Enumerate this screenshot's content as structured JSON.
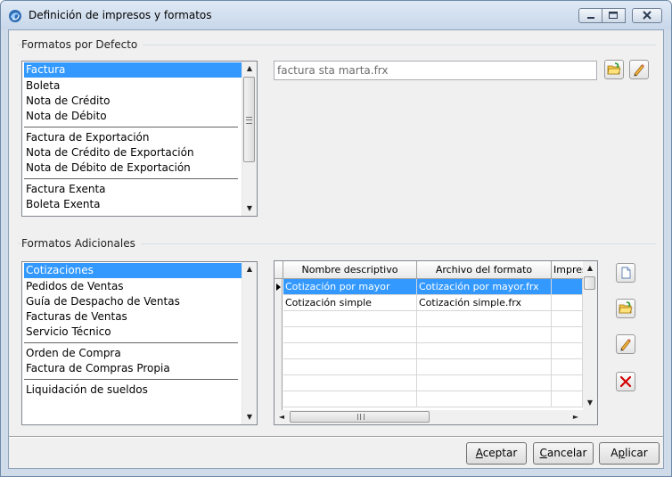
{
  "window": {
    "title": "Definición de impresos y formatos",
    "title_icon": "app-swirl-icon",
    "controls": [
      "minimize-icon",
      "maximize-icon",
      "close-icon"
    ]
  },
  "default_formats": {
    "group_title": "Formatos por Defecto",
    "items": [
      {
        "label": "Factura",
        "selected": true
      },
      {
        "label": "Boleta"
      },
      {
        "label": "Nota de Crédito"
      },
      {
        "label": "Nota de Débito",
        "separator_after": true
      },
      {
        "label": "Factura de Exportación"
      },
      {
        "label": "Nota de Crédito de Exportación"
      },
      {
        "label": "Nota de Débito de Exportación",
        "separator_after": true
      },
      {
        "label": "Factura Exenta"
      },
      {
        "label": "Boleta Exenta"
      }
    ],
    "file_value": "factura sta marta.frx",
    "buttons": [
      "open-folder-icon",
      "edit-pencil-icon"
    ]
  },
  "additional_formats": {
    "group_title": "Formatos Adicionales",
    "items": [
      {
        "label": "Cotizaciones",
        "selected": true
      },
      {
        "label": "Pedidos de Ventas"
      },
      {
        "label": "Guía de Despacho de Ventas"
      },
      {
        "label": "Facturas de Ventas"
      },
      {
        "label": "Servicio Técnico",
        "separator_after": true
      },
      {
        "label": "Orden de Compra"
      },
      {
        "label": "Factura de Compras Propia",
        "separator_after": true
      },
      {
        "label": "Liquidación de sueldos"
      }
    ],
    "grid": {
      "columns": [
        "Nombre descriptivo",
        "Archivo del formato",
        "Impres"
      ],
      "rows": [
        {
          "name": "Cotización por mayor",
          "file": "Cotización por mayor.frx",
          "printer": "",
          "selected": true
        },
        {
          "name": "Cotización simple",
          "file": "Cotización simple.frx",
          "printer": ""
        }
      ]
    },
    "side_buttons": [
      "new-document-icon",
      "open-folder-icon",
      "edit-pencil-icon",
      "delete-x-icon"
    ]
  },
  "footer": {
    "accept": "Aceptar",
    "cancel": "Cancelar",
    "apply": "Aplicar",
    "accept_hotkey": "A",
    "cancel_hotkey": "C",
    "apply_hotkey": "p"
  },
  "colors": {
    "selection": "#3399ff",
    "delete_red": "#d40000",
    "folder_yellow": "#f5c84a"
  }
}
